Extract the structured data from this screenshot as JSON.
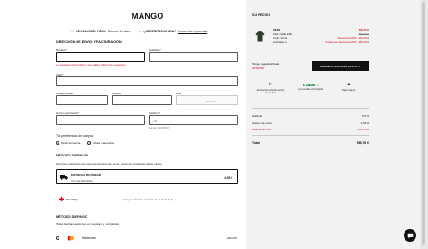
{
  "brand": {
    "logo": "MANGO"
  },
  "topbar": {
    "return_bold": "DEVOLUCIÓN FÁCIL",
    "return_rest": " Durante 14 días",
    "help_bold": "¿NECESITAS AYUDA?",
    "help_link": "Encuentra respuestas"
  },
  "address": {
    "title": "DIRECCIÓN DE ENVÍO Y FACTURACIÓN",
    "name_label": "Nombre*",
    "surname_label": "Apellidos*",
    "name_error": "Los caracteres introducidos no son válidos. Mínimo de 2 caracteres.",
    "street_label": "Calle*",
    "zip_label": "Código postal*",
    "city_label": "Ciudad*",
    "country_label": "País*",
    "country_value": "España",
    "email_label": "Correo electrónico*",
    "phone_label": "Teléfono*",
    "phone_prefix": "+34",
    "phone_hint": "Ejemplo: 612345678"
  },
  "preferences": {
    "title": "Tus preferencias de compra",
    "options": [
      "Moda femenina",
      "Moda masculina"
    ],
    "selected": 0
  },
  "shipping": {
    "title": "MÉTODO DE ENVÍO",
    "subtitle": "Siempre mostramos las mejores opciones de envío, según los productos de su carrito",
    "option_name": "ENTREGA ESTÁNDAR",
    "option_days": "3-6 días laborables",
    "option_price": "4,95 €"
  },
  "donation": {
    "name": "Cruz Roja",
    "desc": "Apoya a Ucrania a través de la Cruz Roja"
  },
  "payment": {
    "title": "MÉTODO DE PAGO",
    "subtitle": "Todas las transacciones son seguras y encriptadas",
    "method": "Mastercard",
    "method_note": "GRATIS"
  },
  "order": {
    "title": "SU PEDIDO",
    "product": {
      "name": "SERO",
      "size": "Talla: ONE SIZE",
      "color": "Color: Verde",
      "qty": "Cantidad: 1",
      "price_now": "559,75 €",
      "price_old": "699,99 €",
      "discount_1": "Descuento 20%: -180,25 €",
      "discount_2": "Código de descuento 20%: -180,25 €"
    },
    "gift": {
      "label": "Tarjeta regalo utilizada",
      "code": "STARTZ5",
      "button": "ELIMINAR TARJETA REGALO"
    },
    "perks": [
      {
        "icon": "return-icon",
        "text": "Devoluciones fáciles dentro de 14 días"
      },
      {
        "icon": "trustpilot-stars",
        "text": "4,2 estrellas en Trustpilot"
      },
      {
        "icon": "lock-icon",
        "text": "Pago Seguro"
      }
    ],
    "summary": {
      "subtotal_label": "Subtotal",
      "subtotal": "747 €",
      "shipping_label": "Gastos de envío",
      "shipping": "4,95 €",
      "discount_label": "Descuento 20%",
      "discount": "-183,15 €",
      "total_label": "Total",
      "total": "568,78 €"
    }
  },
  "colors": {
    "accent_red": "#d0021b",
    "trustpilot_green": "#4aa56a",
    "dark": "#111111"
  }
}
